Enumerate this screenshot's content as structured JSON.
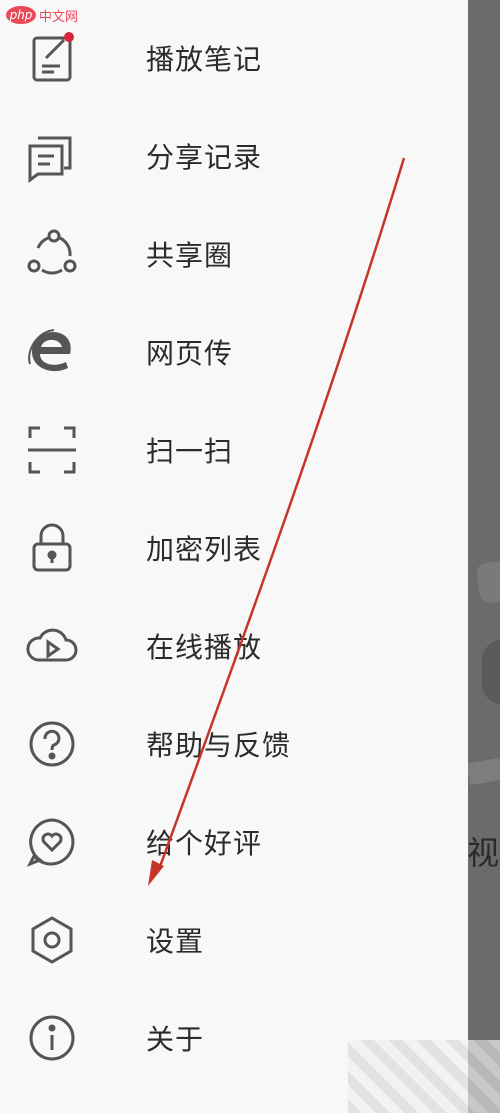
{
  "watermark": {
    "logo": "php",
    "text": "中文网"
  },
  "menu": {
    "items": [
      {
        "label": "播放笔记",
        "icon": "note-icon"
      },
      {
        "label": "分享记录",
        "icon": "share-record-icon"
      },
      {
        "label": "共享圈",
        "icon": "share-circle-icon"
      },
      {
        "label": "网页传",
        "icon": "web-transfer-icon"
      },
      {
        "label": "扫一扫",
        "icon": "scan-icon"
      },
      {
        "label": "加密列表",
        "icon": "lock-icon"
      },
      {
        "label": "在线播放",
        "icon": "cloud-play-icon"
      },
      {
        "label": "帮助与反馈",
        "icon": "help-icon"
      },
      {
        "label": "给个好评",
        "icon": "heart-bubble-icon"
      },
      {
        "label": "设置",
        "icon": "settings-icon"
      },
      {
        "label": "关于",
        "icon": "info-icon"
      }
    ]
  },
  "background_page": {
    "partial_text": "视"
  },
  "colors": {
    "icon": "#555555",
    "text": "#2b2b2b",
    "badge": "#d9233a",
    "arrow": "#c8342a",
    "backdrop": "#6b6b6b"
  }
}
